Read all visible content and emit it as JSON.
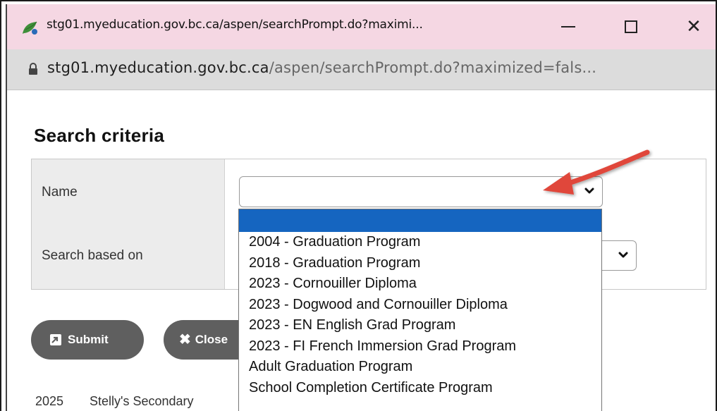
{
  "window": {
    "title": "stg01.myeducation.gov.bc.ca/aspen/searchPrompt.do?maximi...",
    "minimize_label": "—",
    "close_label": "✕"
  },
  "address": {
    "host": "stg01.myeducation.gov.bc.ca",
    "path": "/aspen/searchPrompt.do?maximized=fals..."
  },
  "page": {
    "title": "Search criteria",
    "fields": {
      "name_label": "Name",
      "name_value": "",
      "search_based_on_label": "Search based on"
    },
    "buttons": {
      "submit": "Submit",
      "close": "Close"
    },
    "footer": {
      "year": "2025",
      "school": "Stelly's Secondary"
    }
  },
  "dropdown": {
    "options": [
      "",
      "2004 - Graduation Program",
      "2018 - Graduation Program",
      "2023 - Cornouiller Diploma",
      "2023 - Dogwood and Cornouiller Diploma",
      "2023 - EN English Grad Program",
      "2023 - FI French Immersion Grad Program",
      "Adult Graduation Program",
      "School Completion Certificate Program"
    ],
    "highlighted_index": 0
  },
  "colors": {
    "titlebar": "#f5d7e3",
    "addressbar": "#dcdcdc",
    "highlight": "#1565c0",
    "button": "#5f5f5f",
    "arrow": "#e0463a"
  }
}
